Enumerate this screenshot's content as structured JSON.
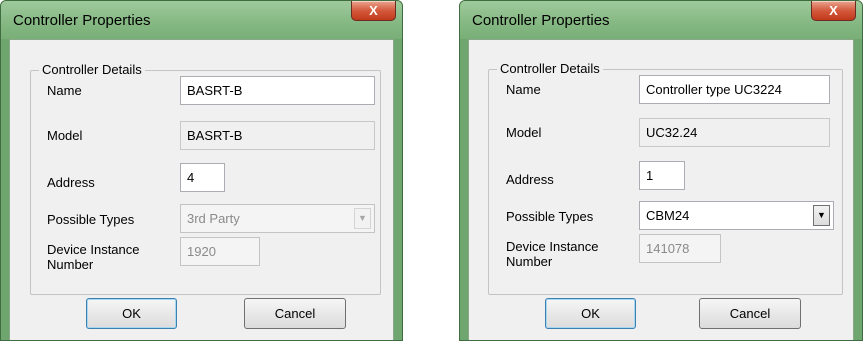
{
  "left_dialog": {
    "title": "Controller Properties",
    "close_glyph": "X",
    "group_title": "Controller Details",
    "name": {
      "label": "Name",
      "value": "BASRT-B"
    },
    "model": {
      "label": "Model",
      "value": "BASRT-B"
    },
    "address": {
      "label": "Address",
      "value": "4"
    },
    "possible_types": {
      "label": "Possible Types",
      "value": "3rd Party",
      "enabled": false
    },
    "device_instance": {
      "label_line1": "Device Instance",
      "label_line2": "Number",
      "value": "1920"
    },
    "ok_label": "OK",
    "cancel_label": "Cancel"
  },
  "right_dialog": {
    "title": "Controller Properties",
    "close_glyph": "X",
    "group_title": "Controller Details",
    "name": {
      "label": "Name",
      "value": "Controller type UC3224"
    },
    "model": {
      "label": "Model",
      "value": "UC32.24"
    },
    "address": {
      "label": "Address",
      "value": "1"
    },
    "possible_types": {
      "label": "Possible Types",
      "value": "CBM24",
      "enabled": true
    },
    "device_instance": {
      "label_line1": "Device Instance",
      "label_line2": "Number",
      "value": "141078"
    },
    "ok_label": "OK",
    "cancel_label": "Cancel"
  },
  "icons": {
    "close": "close-icon",
    "dropdown": "chevron-down-icon"
  },
  "colors": {
    "title_bar": "#86b984",
    "frame": "#6fa56e",
    "close_button": "#c7402a",
    "client_area": "#f0f0f0"
  }
}
